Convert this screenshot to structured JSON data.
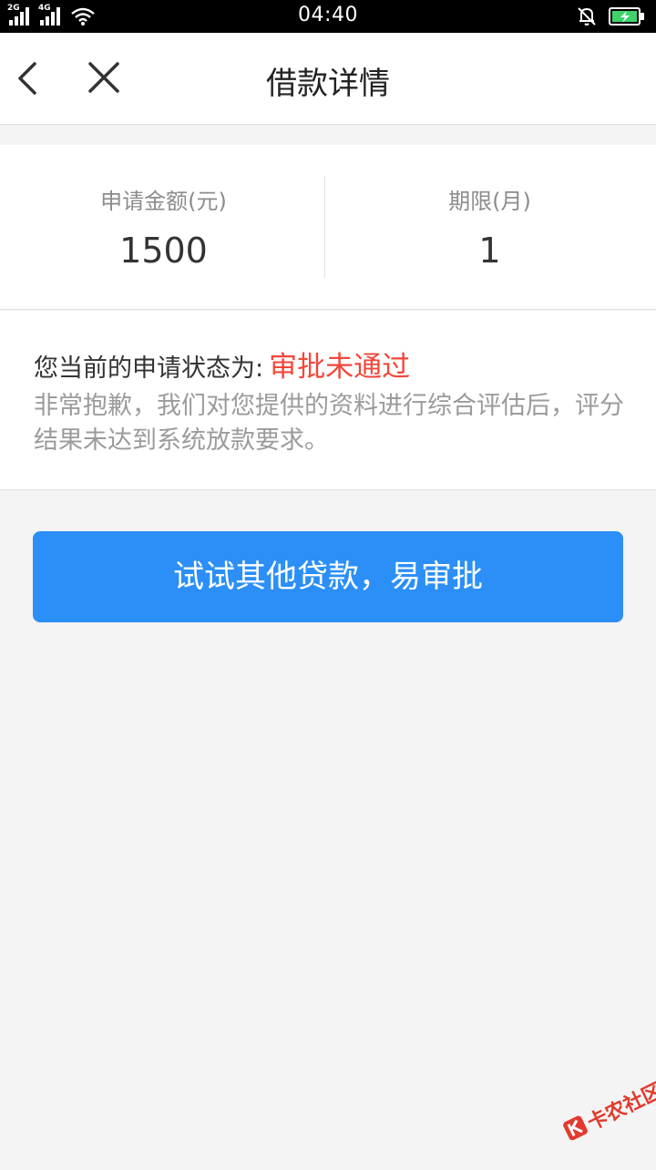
{
  "status_bar": {
    "time": "04:40",
    "signal_1_label": "2G",
    "signal_2_label": "4G"
  },
  "header": {
    "title": "借款详情",
    "back_icon": "chevron-left-icon",
    "close_icon": "close-icon"
  },
  "loan_info": {
    "amount_label": "申请金额(元)",
    "amount_value": "1500",
    "term_label": "期限(月)",
    "term_value": "1"
  },
  "application_status": {
    "prefix": "您当前的申请状态为:",
    "result": "审批未通过",
    "result_color": "#f2473a",
    "description": "非常抱歉，我们对您提供的资料进行综合评估后，评分结果未达到系统放款要求。"
  },
  "action_button": {
    "label": "试试其他贷款，易审批",
    "color": "#2b8ff7"
  },
  "watermark": {
    "text": "卡农社区"
  }
}
